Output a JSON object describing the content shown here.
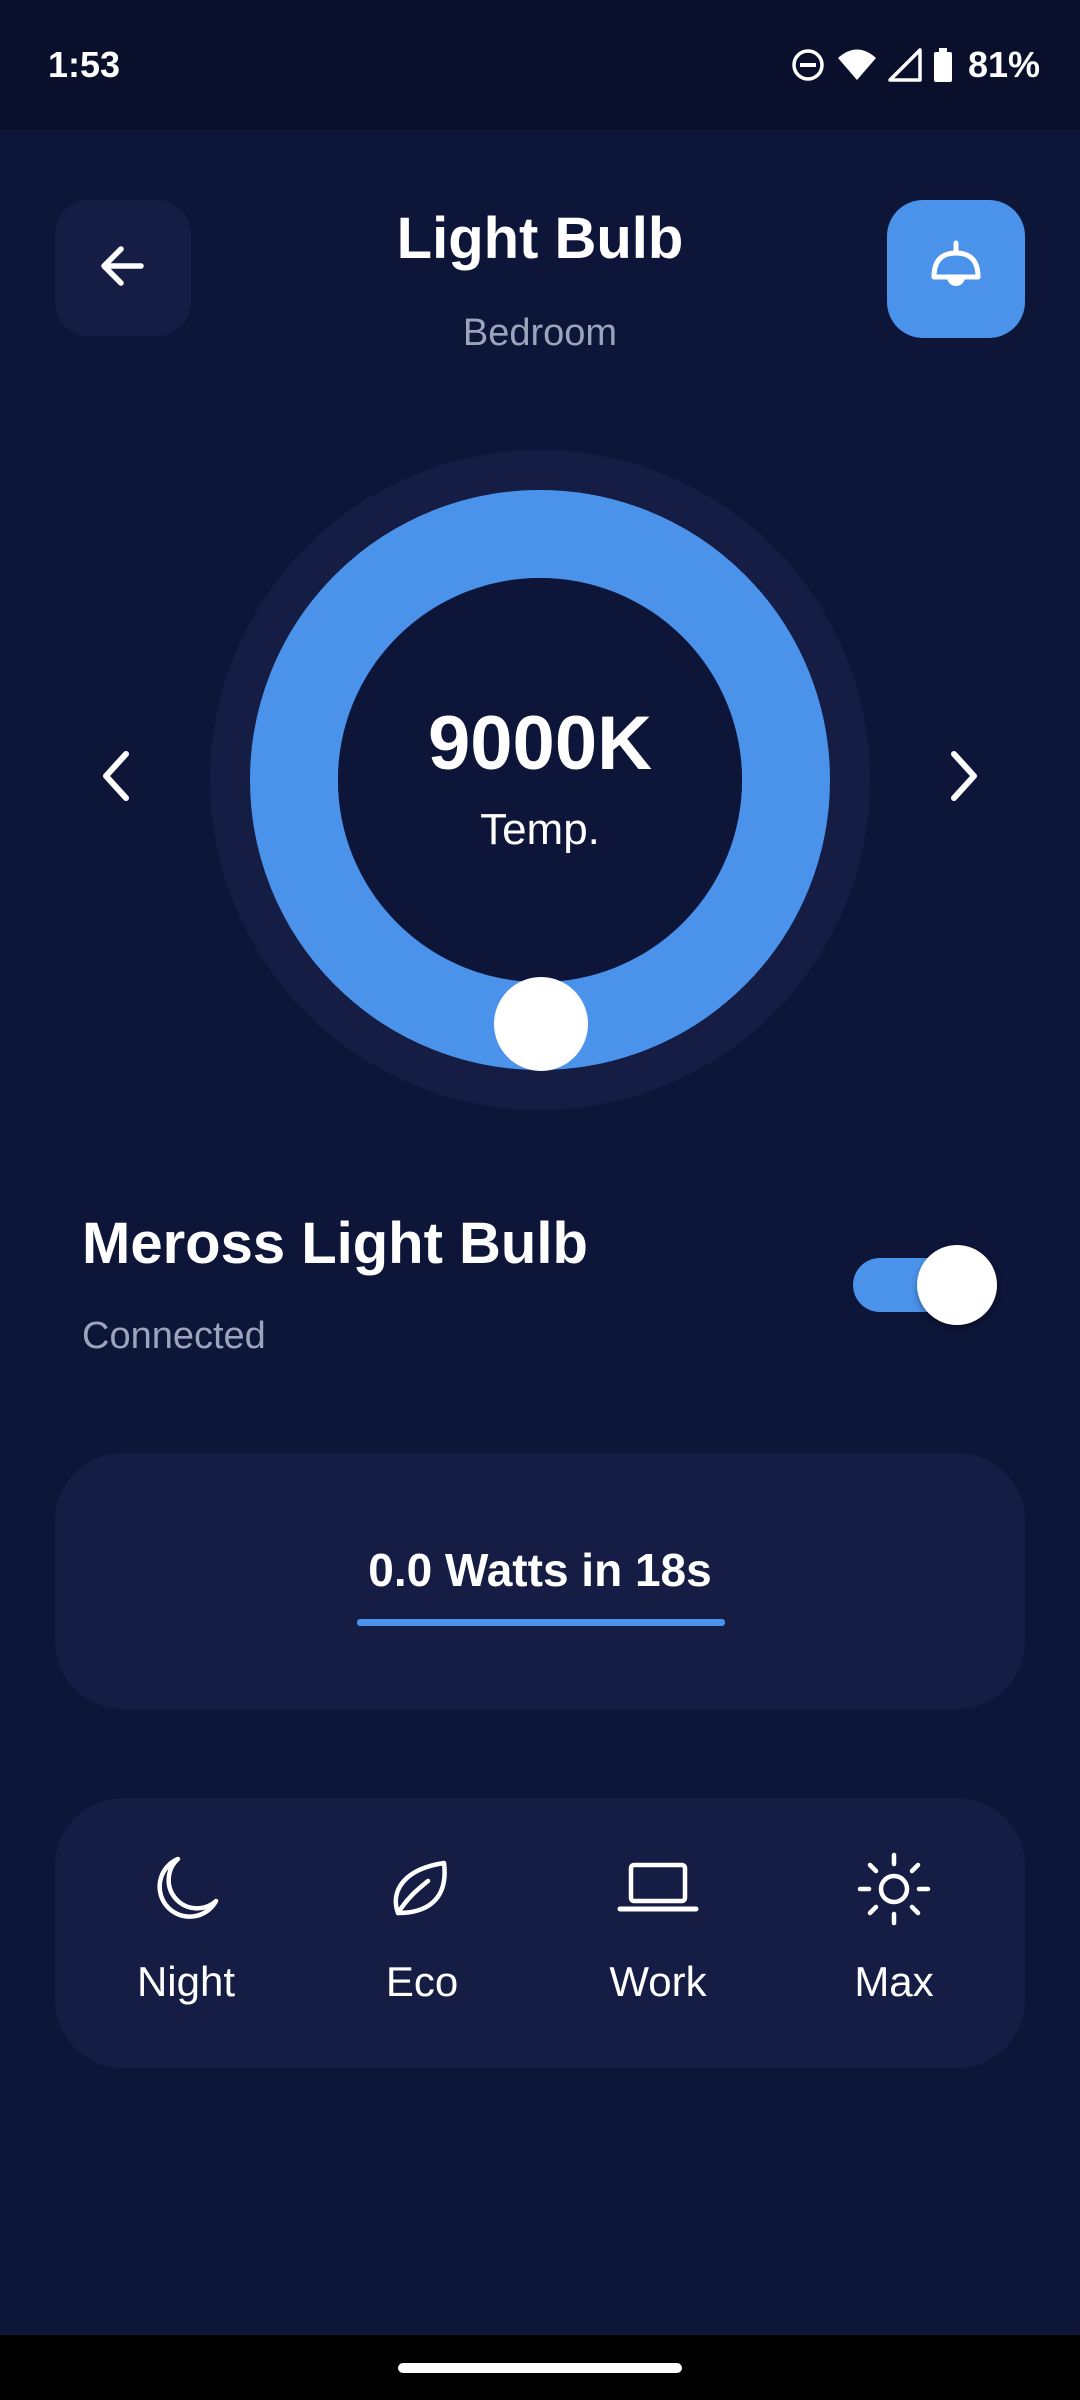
{
  "status_bar": {
    "time": "1:53",
    "battery_percent": "81%",
    "icons": [
      "do-not-disturb-icon",
      "wifi-icon",
      "cell-signal-icon",
      "battery-icon"
    ]
  },
  "header": {
    "title": "Light Bulb",
    "subtitle": "Bedroom",
    "back_icon": "arrow-left-icon",
    "device_icon": "pendant-lamp-icon"
  },
  "dial": {
    "value": "9000K",
    "label": "Temp.",
    "prev_icon": "chevron-left-icon",
    "next_icon": "chevron-right-icon"
  },
  "device": {
    "name": "Meross Light Bulb",
    "status": "Connected",
    "power_on": true
  },
  "usage": {
    "text": "0.0 Watts in 18s"
  },
  "modes": [
    {
      "label": "Night",
      "icon": "moon-icon"
    },
    {
      "label": "Eco",
      "icon": "leaf-icon"
    },
    {
      "label": "Work",
      "icon": "laptop-icon"
    },
    {
      "label": "Max",
      "icon": "sun-icon"
    }
  ],
  "colors": {
    "background": "#0d1538",
    "status_bar": "#0a0f2c",
    "card": "#151d44",
    "accent": "#4a92ea",
    "muted_text": "#9ba3bd"
  }
}
